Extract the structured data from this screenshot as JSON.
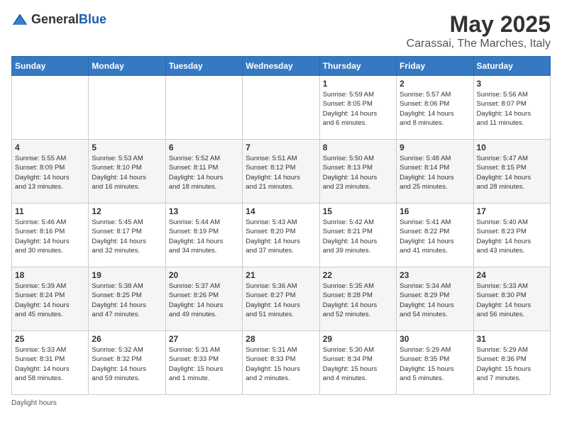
{
  "logo": {
    "general": "General",
    "blue": "Blue"
  },
  "title": "May 2025",
  "location": "Carassai, The Marches, Italy",
  "days_of_week": [
    "Sunday",
    "Monday",
    "Tuesday",
    "Wednesday",
    "Thursday",
    "Friday",
    "Saturday"
  ],
  "footer": "Daylight hours",
  "weeks": [
    [
      {
        "day": "",
        "info": ""
      },
      {
        "day": "",
        "info": ""
      },
      {
        "day": "",
        "info": ""
      },
      {
        "day": "",
        "info": ""
      },
      {
        "day": "1",
        "info": "Sunrise: 5:59 AM\nSunset: 8:05 PM\nDaylight: 14 hours\nand 6 minutes."
      },
      {
        "day": "2",
        "info": "Sunrise: 5:57 AM\nSunset: 8:06 PM\nDaylight: 14 hours\nand 8 minutes."
      },
      {
        "day": "3",
        "info": "Sunrise: 5:56 AM\nSunset: 8:07 PM\nDaylight: 14 hours\nand 11 minutes."
      }
    ],
    [
      {
        "day": "4",
        "info": "Sunrise: 5:55 AM\nSunset: 8:09 PM\nDaylight: 14 hours\nand 13 minutes."
      },
      {
        "day": "5",
        "info": "Sunrise: 5:53 AM\nSunset: 8:10 PM\nDaylight: 14 hours\nand 16 minutes."
      },
      {
        "day": "6",
        "info": "Sunrise: 5:52 AM\nSunset: 8:11 PM\nDaylight: 14 hours\nand 18 minutes."
      },
      {
        "day": "7",
        "info": "Sunrise: 5:51 AM\nSunset: 8:12 PM\nDaylight: 14 hours\nand 21 minutes."
      },
      {
        "day": "8",
        "info": "Sunrise: 5:50 AM\nSunset: 8:13 PM\nDaylight: 14 hours\nand 23 minutes."
      },
      {
        "day": "9",
        "info": "Sunrise: 5:48 AM\nSunset: 8:14 PM\nDaylight: 14 hours\nand 25 minutes."
      },
      {
        "day": "10",
        "info": "Sunrise: 5:47 AM\nSunset: 8:15 PM\nDaylight: 14 hours\nand 28 minutes."
      }
    ],
    [
      {
        "day": "11",
        "info": "Sunrise: 5:46 AM\nSunset: 8:16 PM\nDaylight: 14 hours\nand 30 minutes."
      },
      {
        "day": "12",
        "info": "Sunrise: 5:45 AM\nSunset: 8:17 PM\nDaylight: 14 hours\nand 32 minutes."
      },
      {
        "day": "13",
        "info": "Sunrise: 5:44 AM\nSunset: 8:19 PM\nDaylight: 14 hours\nand 34 minutes."
      },
      {
        "day": "14",
        "info": "Sunrise: 5:43 AM\nSunset: 8:20 PM\nDaylight: 14 hours\nand 37 minutes."
      },
      {
        "day": "15",
        "info": "Sunrise: 5:42 AM\nSunset: 8:21 PM\nDaylight: 14 hours\nand 39 minutes."
      },
      {
        "day": "16",
        "info": "Sunrise: 5:41 AM\nSunset: 8:22 PM\nDaylight: 14 hours\nand 41 minutes."
      },
      {
        "day": "17",
        "info": "Sunrise: 5:40 AM\nSunset: 8:23 PM\nDaylight: 14 hours\nand 43 minutes."
      }
    ],
    [
      {
        "day": "18",
        "info": "Sunrise: 5:39 AM\nSunset: 8:24 PM\nDaylight: 14 hours\nand 45 minutes."
      },
      {
        "day": "19",
        "info": "Sunrise: 5:38 AM\nSunset: 8:25 PM\nDaylight: 14 hours\nand 47 minutes."
      },
      {
        "day": "20",
        "info": "Sunrise: 5:37 AM\nSunset: 8:26 PM\nDaylight: 14 hours\nand 49 minutes."
      },
      {
        "day": "21",
        "info": "Sunrise: 5:36 AM\nSunset: 8:27 PM\nDaylight: 14 hours\nand 51 minutes."
      },
      {
        "day": "22",
        "info": "Sunrise: 5:35 AM\nSunset: 8:28 PM\nDaylight: 14 hours\nand 52 minutes."
      },
      {
        "day": "23",
        "info": "Sunrise: 5:34 AM\nSunset: 8:29 PM\nDaylight: 14 hours\nand 54 minutes."
      },
      {
        "day": "24",
        "info": "Sunrise: 5:33 AM\nSunset: 8:30 PM\nDaylight: 14 hours\nand 56 minutes."
      }
    ],
    [
      {
        "day": "25",
        "info": "Sunrise: 5:33 AM\nSunset: 8:31 PM\nDaylight: 14 hours\nand 58 minutes."
      },
      {
        "day": "26",
        "info": "Sunrise: 5:32 AM\nSunset: 8:32 PM\nDaylight: 14 hours\nand 59 minutes."
      },
      {
        "day": "27",
        "info": "Sunrise: 5:31 AM\nSunset: 8:33 PM\nDaylight: 15 hours\nand 1 minute."
      },
      {
        "day": "28",
        "info": "Sunrise: 5:31 AM\nSunset: 8:33 PM\nDaylight: 15 hours\nand 2 minutes."
      },
      {
        "day": "29",
        "info": "Sunrise: 5:30 AM\nSunset: 8:34 PM\nDaylight: 15 hours\nand 4 minutes."
      },
      {
        "day": "30",
        "info": "Sunrise: 5:29 AM\nSunset: 8:35 PM\nDaylight: 15 hours\nand 5 minutes."
      },
      {
        "day": "31",
        "info": "Sunrise: 5:29 AM\nSunset: 8:36 PM\nDaylight: 15 hours\nand 7 minutes."
      }
    ]
  ]
}
